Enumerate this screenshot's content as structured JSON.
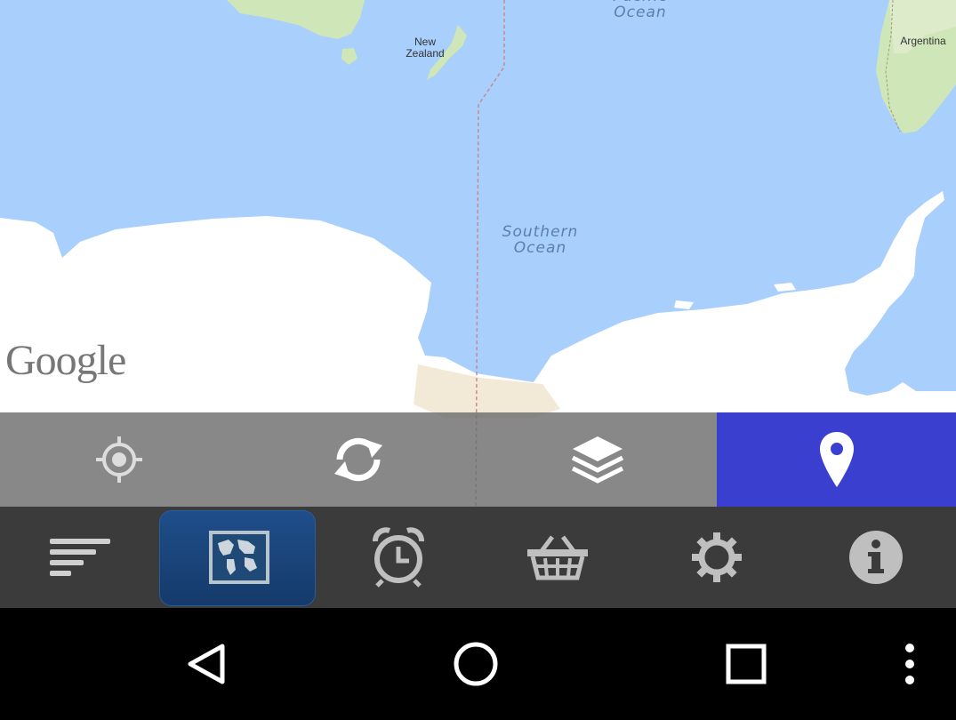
{
  "map": {
    "labels": {
      "pacific_ocean_partial": "Pacific\nOcean",
      "southern_ocean": "Southern\nOcean",
      "new_zealand": "New\nZealand",
      "argentina": "Argentina"
    },
    "attribution": "Google",
    "colors": {
      "water": "#a9cffc",
      "land_green": "#cfe6b8",
      "land_tan": "#f2ead7",
      "ice": "#ffffff"
    }
  },
  "map_toolbar": {
    "buttons": [
      {
        "name": "my-location",
        "icon": "crosshair-icon",
        "active": false
      },
      {
        "name": "refresh",
        "icon": "refresh-icon",
        "active": false
      },
      {
        "name": "layers",
        "icon": "layers-icon",
        "active": false
      },
      {
        "name": "marker",
        "icon": "map-pin-icon",
        "active": true
      }
    ],
    "active_color": "#3b3fd0"
  },
  "nav_tabs": {
    "items": [
      {
        "name": "menu",
        "icon": "sort-lines-icon",
        "selected": false
      },
      {
        "name": "world-map",
        "icon": "world-map-icon",
        "selected": true
      },
      {
        "name": "alarm",
        "icon": "alarm-clock-icon",
        "selected": false
      },
      {
        "name": "shop",
        "icon": "basket-icon",
        "selected": false
      },
      {
        "name": "settings",
        "icon": "gear-icon",
        "selected": false
      },
      {
        "name": "info",
        "icon": "info-icon",
        "selected": false
      }
    ],
    "selected_color": "#1f4e8a"
  },
  "system_bar": {
    "buttons": [
      "back-icon",
      "home-icon",
      "recents-icon",
      "overflow-menu-icon"
    ]
  }
}
